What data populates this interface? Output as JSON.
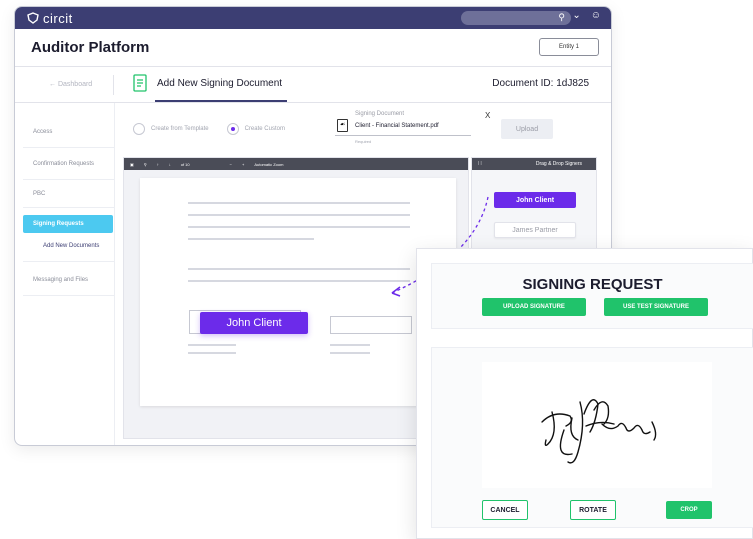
{
  "app": {
    "logo_text": "circit",
    "title": "Auditor Platform",
    "entity_button": "Entity 1"
  },
  "crumbs": {
    "dashboard": "Dashboard",
    "heading": "Add New Signing Document",
    "document_id": "Document ID: 1dJ825"
  },
  "sidebar": {
    "items": [
      {
        "label": "Access"
      },
      {
        "label": "Confirmation Requests"
      },
      {
        "label": "PBC"
      },
      {
        "label": "Signing Requests"
      },
      {
        "label": "Messaging and Files"
      }
    ],
    "sub_item": "Add New Documents"
  },
  "form": {
    "radio_template": "Create from Template",
    "radio_custom": "Create Custom",
    "signing_doc_label": "Signing Document",
    "file_name": "Client - Financial Statement.pdf",
    "required": "Required",
    "clear": "X",
    "upload": "Upload"
  },
  "viewer": {
    "page_info": "of 10",
    "zoom": "Automatic Zoom"
  },
  "signers": {
    "title": "Drag & Drop Signers",
    "list": [
      "John Client",
      "James Partner"
    ]
  },
  "drag_chip": "John Client",
  "modal": {
    "title": "SIGNING REQUEST",
    "upload_signature": "UPLOAD SIGNATURE",
    "use_test_signature": "USE TEST SIGNATURE",
    "cancel": "CANCEL",
    "rotate": "ROTATE",
    "crop": "CROP"
  },
  "colors": {
    "topbar": "#3c3e73",
    "primary_purple": "#6c2bea",
    "active_cyan": "#4cc9f0",
    "green": "#20c36b"
  }
}
